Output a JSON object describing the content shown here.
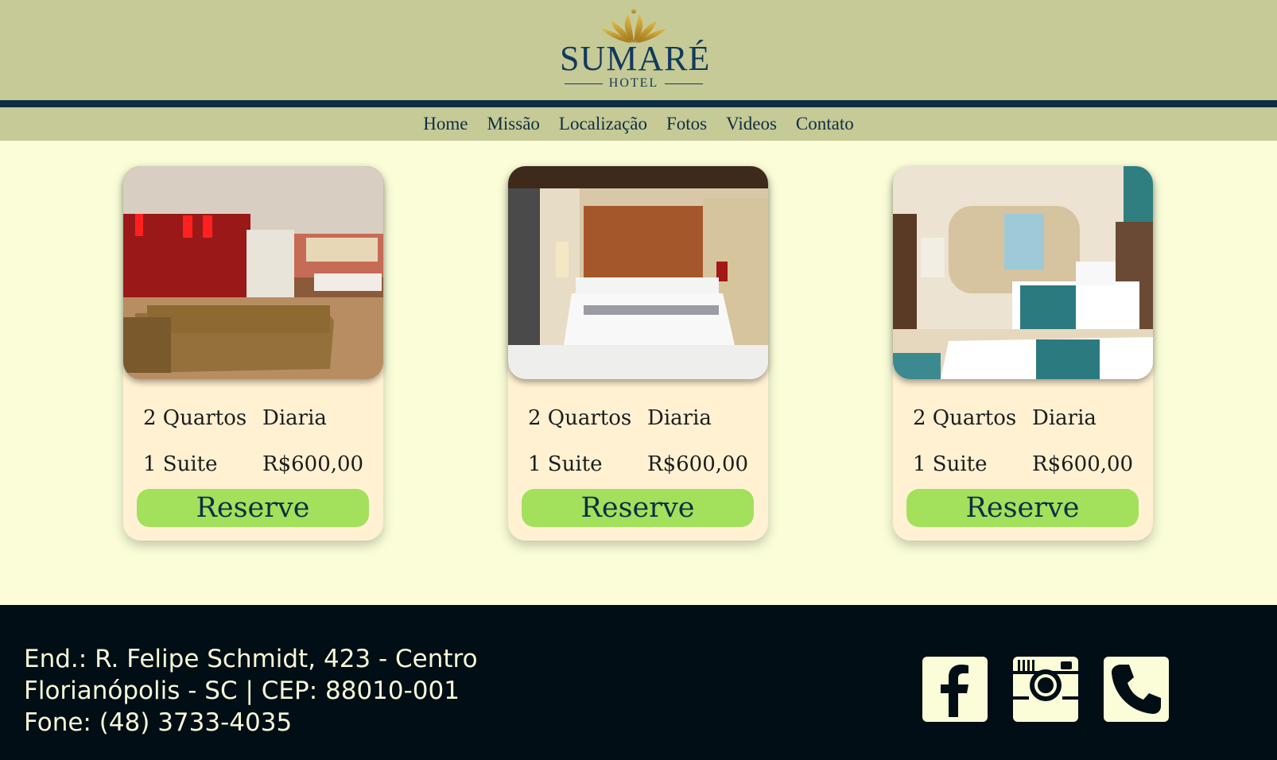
{
  "brand": {
    "name": "SUMARÉ",
    "subtitle": "HOTEL"
  },
  "nav": {
    "items": [
      "Home",
      "Missão",
      "Localização",
      "Fotos",
      "Videos",
      "Contato"
    ]
  },
  "cards": [
    {
      "rooms": "2 Quartos",
      "suites": "1 Suite",
      "rate_label": "Diaria",
      "price": "R$600,00",
      "button": "Reserve"
    },
    {
      "rooms": "2 Quartos",
      "suites": "1 Suite",
      "rate_label": "Diaria",
      "price": "R$600,00",
      "button": "Reserve"
    },
    {
      "rooms": "2 Quartos",
      "suites": "1 Suite",
      "rate_label": "Diaria",
      "price": "R$600,00",
      "button": "Reserve"
    }
  ],
  "footer": {
    "address_line1": "End.: R. Felipe Schmidt, 423 - Centro",
    "address_line2": "Florianópolis - SC | CEP: 88010-001",
    "phone_line": "Fone: (48) 3733-4035",
    "social_icons": [
      "facebook-icon",
      "instagram-icon",
      "phone-icon"
    ]
  },
  "colors": {
    "header_bg": "#c6ca96",
    "stripe": "#0d2f45",
    "page_bg": "#fafdd8",
    "card_bg": "#fff1d2",
    "button_bg": "#a3e05c",
    "footer_bg": "#020e15",
    "logo_gold": "#c49a2c"
  }
}
